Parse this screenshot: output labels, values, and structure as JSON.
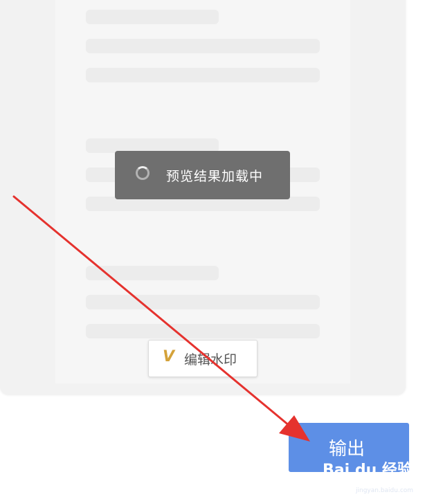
{
  "preview": {
    "loading_text": "预览结果加载中"
  },
  "watermark_button": {
    "icon": "v-logo-icon",
    "icon_glyph": "V",
    "label": "编辑水印"
  },
  "export_button": {
    "label": "输出"
  },
  "site_watermark": {
    "brand": "Bai du 经验",
    "domain": "jingyan.baidu.com"
  },
  "colors": {
    "accent": "#5d8fe6",
    "toast_bg": "#6f6f6f",
    "annotation_arrow": "#e5322e",
    "watermark_icon": "#d4a23a"
  }
}
